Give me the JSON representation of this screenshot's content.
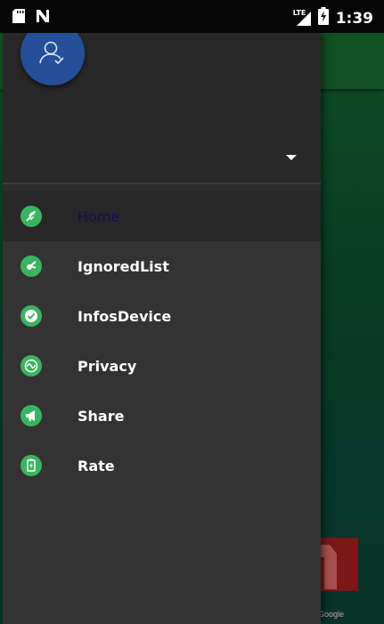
{
  "status_bar": {
    "time": "1:39",
    "network": "LTE",
    "icons": [
      "sd-card-icon",
      "n-icon",
      "signal-icon",
      "battery-charging-icon"
    ]
  },
  "drawer": {
    "header": {
      "avatar_icon": "user-check-icon",
      "dropdown_icon": "caret-down-icon"
    },
    "menu": [
      {
        "label": "Home",
        "icon": "signal-broadcast-icon",
        "active": true
      },
      {
        "label": "IgnoredList",
        "icon": "leaf-icon",
        "active": false
      },
      {
        "label": "InfosDevice",
        "icon": "check-circle-icon",
        "active": false
      },
      {
        "label": "Privacy",
        "icon": "wave-icon",
        "active": false
      },
      {
        "label": "Share",
        "icon": "megaphone-icon",
        "active": false
      },
      {
        "label": "Rate",
        "icon": "battery-icon",
        "active": false
      }
    ]
  },
  "background_app": {
    "ad_text": "y Google"
  },
  "colors": {
    "accent": "#3cb360",
    "avatar_bg": "#264f99",
    "drawer_bg": "#333333",
    "active_label": "#1d0a57",
    "app_green": "#176b2d"
  }
}
